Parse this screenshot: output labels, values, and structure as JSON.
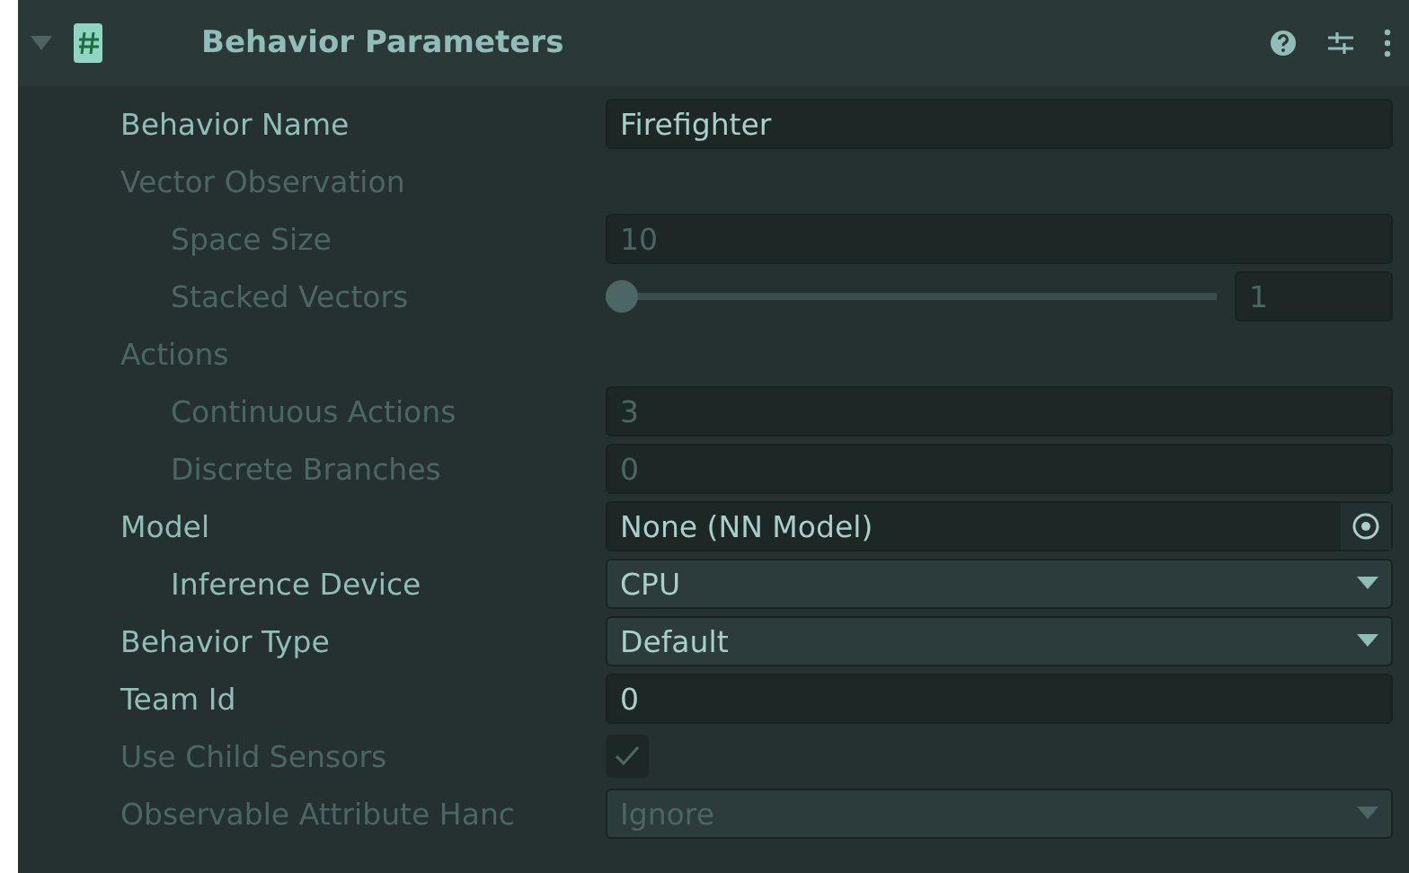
{
  "component": {
    "title": "Behavior Parameters",
    "expanded": true,
    "enabled": true
  },
  "properties": [
    {
      "kind": "text",
      "label": "Behavior Name",
      "value": "Firefighter",
      "disabled": false
    },
    {
      "kind": "group",
      "label": "Vector Observation",
      "disabled": true,
      "children": [
        {
          "kind": "text",
          "label": "Space Size",
          "value": "10",
          "disabled": true
        },
        {
          "kind": "slider",
          "label": "Stacked Vectors",
          "value": "1",
          "level": 0,
          "disabled": true
        }
      ]
    },
    {
      "kind": "group",
      "label": "Actions",
      "disabled": true,
      "children": [
        {
          "kind": "text",
          "label": "Continuous Actions",
          "value": "3",
          "disabled": true
        },
        {
          "kind": "text",
          "label": "Discrete Branches",
          "value": "0",
          "disabled": true
        }
      ]
    },
    {
      "kind": "object",
      "label": "Model",
      "value": "None (NN Model)",
      "disabled": false,
      "children": [
        {
          "kind": "dropdown",
          "label": "Inference Device",
          "value": "CPU",
          "disabled": false
        }
      ]
    },
    {
      "kind": "dropdown",
      "label": "Behavior Type",
      "value": "Default",
      "disabled": false
    },
    {
      "kind": "text",
      "label": "Team Id",
      "value": "0",
      "disabled": false
    },
    {
      "kind": "checkbox",
      "label": "Use Child Sensors",
      "checked": true,
      "disabled": true
    },
    {
      "kind": "dropdown",
      "label": "Observable Attribute Hanc",
      "value": "Ignore",
      "disabled": true
    }
  ]
}
